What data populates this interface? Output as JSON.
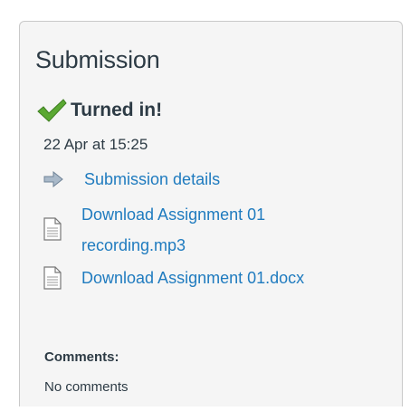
{
  "submission": {
    "title": "Submission",
    "status": "Turned in!",
    "date": "22 Apr at 15:25"
  },
  "links": {
    "details": "Submission details",
    "audio_line1": "Download Assignment 01",
    "audio_line2": "recording.mp3",
    "docx": "Download Assignment 01.docx"
  },
  "comments": {
    "label": "Comments:",
    "value": "No comments"
  },
  "colors": {
    "link": "#1f7bbf",
    "check": "#4c9a2a",
    "text": "#2d3b45"
  },
  "icons": [
    "check-icon",
    "arrow-right-icon",
    "document-icon"
  ]
}
